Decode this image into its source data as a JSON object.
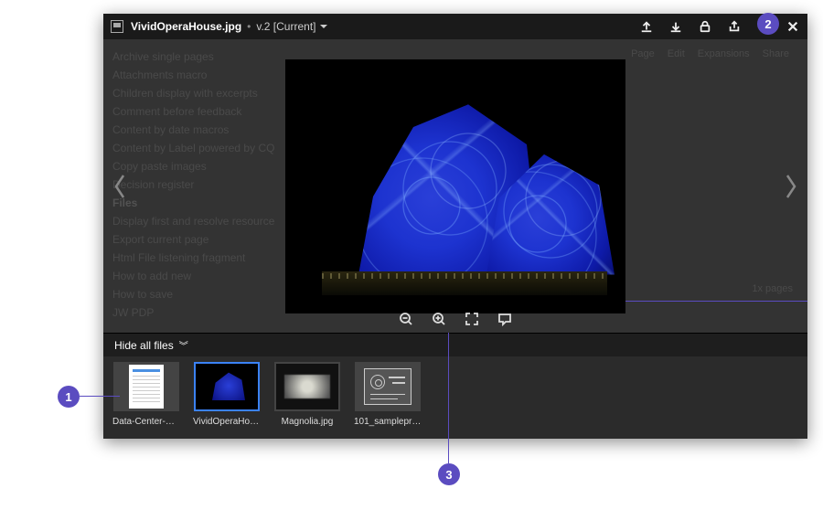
{
  "titlebar": {
    "filename": "VividOperaHouse.jpg",
    "version": "v.2 [Current]"
  },
  "bg_list": {
    "items": [
      "Archive single pages",
      "Attachments macro",
      "Children display with excerpts",
      "Comment before feedback",
      "Content by date macros",
      "Content by Label powered by CQ",
      "Copy paste images",
      "Decision register"
    ],
    "heading": "Files",
    "items2": [
      "Display first and resolve resource",
      "Export current page",
      "Html File listening fragment",
      "How to add new",
      "How to save",
      "JW PDP"
    ],
    "right_label": "1x pages",
    "top_right": [
      "Page",
      "Edit",
      "Expansions",
      "Share"
    ]
  },
  "toolbar": {
    "zoom_out": "zoom-out",
    "zoom_in": "zoom-in",
    "fullscreen": "fullscreen",
    "comment": "comment"
  },
  "files_panel": {
    "toggle_label": "Hide all files"
  },
  "thumbnails": [
    {
      "label": "Data-Center-C…",
      "kind": "doc",
      "selected": false
    },
    {
      "label": "VividOperaHou…",
      "kind": "opera",
      "selected": true
    },
    {
      "label": "Magnolia.jpg",
      "kind": "magnolia",
      "selected": false
    },
    {
      "label": "101_samplepre…",
      "kind": "slide",
      "selected": false
    }
  ],
  "callouts": {
    "c1": "1",
    "c2": "2",
    "c3": "3"
  }
}
